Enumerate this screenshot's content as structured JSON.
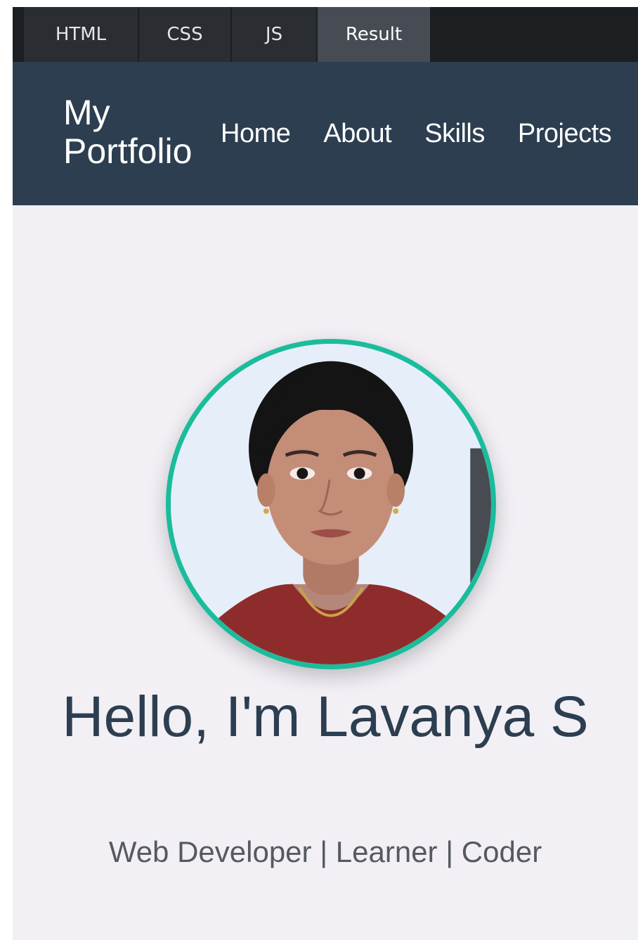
{
  "editor": {
    "tabs": [
      {
        "label": "HTML"
      },
      {
        "label": "CSS"
      },
      {
        "label": "JS"
      },
      {
        "label": "Result",
        "active": true
      }
    ]
  },
  "nav": {
    "logo": "My Portfolio",
    "links": [
      {
        "label": "Home"
      },
      {
        "label": "About"
      },
      {
        "label": "Skills"
      },
      {
        "label": "Projects"
      }
    ]
  },
  "hero": {
    "title": "Hello, I'm Lavanya S",
    "subtitle": "Web Developer | Learner | Coder",
    "avatar_icon": "profile-photo"
  },
  "colors": {
    "nav_bg": "#2c3e50",
    "accent": "#1abc9c",
    "page_bg": "#f2f0f5",
    "title": "#2c3e50"
  }
}
